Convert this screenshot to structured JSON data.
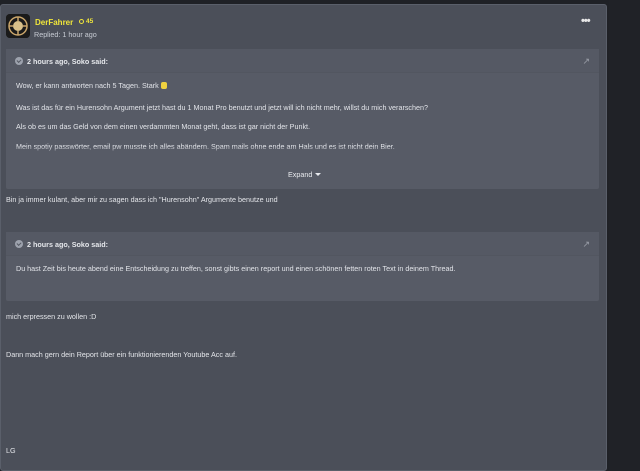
{
  "post": {
    "username": "DerFahrer",
    "badge_count": "45",
    "replied": "Replied: 1 hour ago",
    "menu_icon": "ellipsis-icon"
  },
  "quote1": {
    "title": "2 hours ago, Soko said:",
    "lines": [
      "Wow, er kann antworten nach 5 Tagen. Stark",
      "Was ist das für ein Hurensohn Argument jetzt hast du 1 Monat Pro benutzt und jetzt will ich nicht mehr, willst du mich verarschen?",
      "Als ob es um das Geld von dem einen verdammten Monat geht, dass ist gar nicht der Punkt.",
      "Mein spotiy passwörter, email pw musste ich alles abändern. Spam mails ohne ende am Hals und es ist nicht dein Bier."
    ],
    "expand_label": "Expand"
  },
  "reply1": "Bin ja immer kulant, aber mir zu sagen dass ich \"Hurensohn\" Argumente benutze und",
  "quote2": {
    "title": "2 hours ago, Soko said:",
    "lines": [
      "Du hast Zeit bis heute abend eine Entscheidung zu treffen, sonst gibts einen report und einen schönen fetten roten Text in deinem Thread."
    ]
  },
  "reply2": "mich erpressen zu wollen :D",
  "reply3": "Dann mach gern dein Report über ein funktionierenden Youtube Acc auf.",
  "reply4": "LG"
}
